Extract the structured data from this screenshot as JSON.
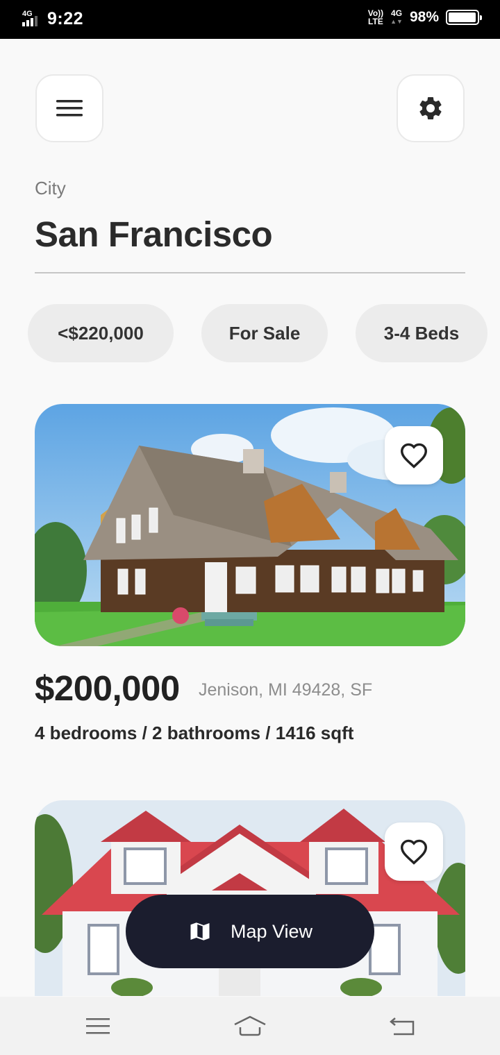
{
  "status_bar": {
    "network": "4G",
    "time": "9:22",
    "volte_top": "Vo))",
    "volte_bottom": "LTE",
    "data_type": "4G",
    "battery_percent": "98%",
    "battery_level": 0.98
  },
  "header": {
    "menu_icon": "hamburger-icon",
    "settings_icon": "gear-icon"
  },
  "search": {
    "city_label": "City",
    "city_value": "San Francisco"
  },
  "filters": [
    {
      "label": "<$220,000"
    },
    {
      "label": "For Sale"
    },
    {
      "label": "3-4 Beds"
    }
  ],
  "listings": [
    {
      "price": "$200,000",
      "address": "Jenison, MI 49428, SF",
      "specs": "4 bedrooms / 2 bathrooms / 1416 sqft",
      "favorite_icon": "heart-outline-icon"
    },
    {
      "favorite_icon": "heart-outline-icon"
    }
  ],
  "map_button": {
    "label": "Map View",
    "icon": "map-icon"
  },
  "nav_bar": {
    "recents_icon": "recents-icon",
    "home_icon": "home-icon",
    "back_icon": "back-icon"
  },
  "colors": {
    "background": "#f9f9f9",
    "chip_background": "#ececec",
    "map_button_background": "#1b1d2e"
  }
}
